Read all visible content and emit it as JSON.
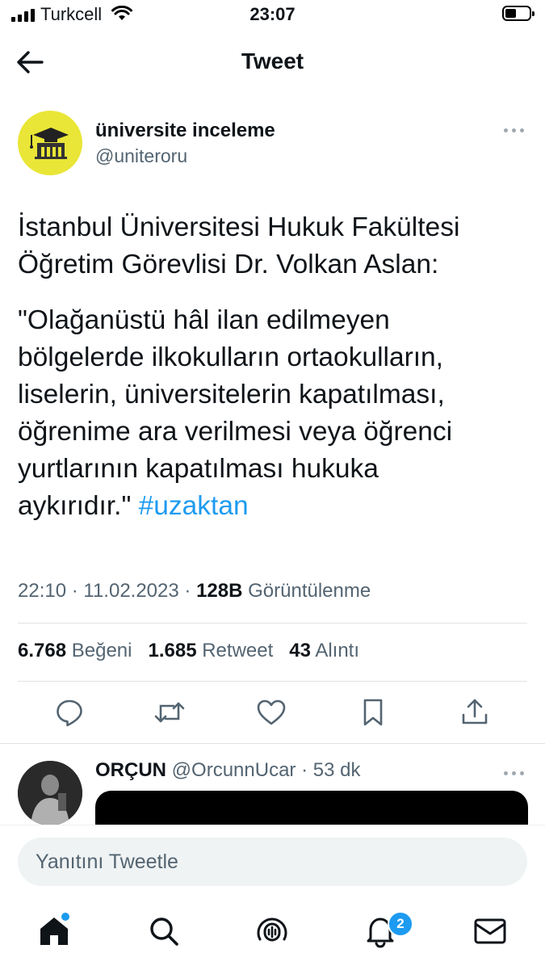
{
  "status_bar": {
    "carrier": "Turkcell",
    "time": "23:07"
  },
  "header": {
    "title": "Tweet"
  },
  "tweet": {
    "author_name": "üniversite inceleme",
    "author_handle": "@uniteroru",
    "paragraph1_line1": "İstanbul Üniversitesi Hukuk Fakültesi",
    "paragraph1_line2": "Öğretim Görevlisi Dr. Volkan Aslan:",
    "quote_lines": [
      "\"Olağanüstü hâl ilan edilmeyen",
      "bölgelerde ilkokulların ortaokulların,",
      "liselerin, üniversitelerin kapatılması,",
      "öğrenime ara verilmesi veya öğrenci",
      "yurtlarının kapatılması hukuka",
      "aykırıdır.\" "
    ],
    "hashtag": "#uzaktan",
    "time": "22:10",
    "date": "11.02.2023",
    "views_count": "128B",
    "views_label": "Görüntülenme",
    "likes_count": "6.768",
    "likes_label": "Beğeni",
    "retweets_count": "1.685",
    "retweets_label": "Retweet",
    "quotes_count": "43",
    "quotes_label": "Alıntı"
  },
  "actions": [
    "reply-icon",
    "retweet-icon",
    "like-icon",
    "bookmark-icon",
    "share-icon"
  ],
  "reply": {
    "name": "ORÇUN",
    "handle": "@OrcunnUcar",
    "time": "53 dk"
  },
  "composer": {
    "placeholder": "Yanıtını Tweetle"
  },
  "tab_bar": {
    "items": [
      "home-icon",
      "search-icon",
      "spaces-icon",
      "notifications-icon",
      "messages-icon"
    ],
    "notification_badge": "2"
  },
  "colors": {
    "accent": "#1d9bf0",
    "text": "#0f1419",
    "muted": "#536471",
    "avatar_bg": "#e9e637"
  }
}
